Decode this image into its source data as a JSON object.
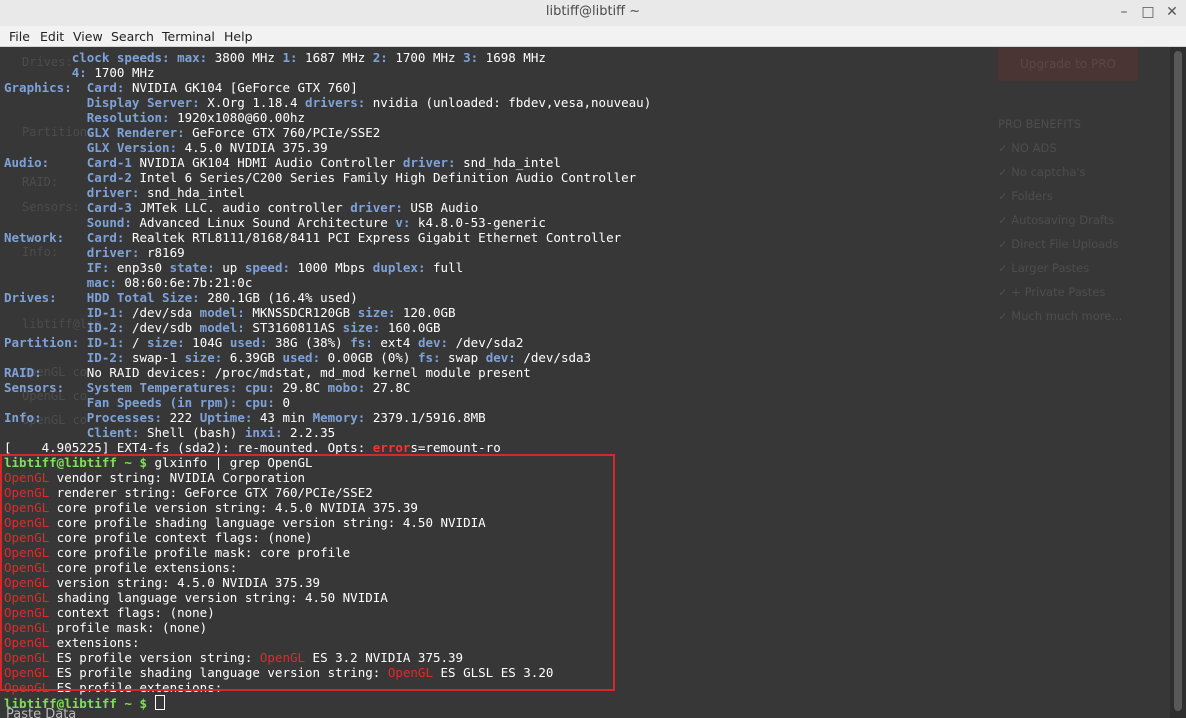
{
  "window": {
    "title": "libtiff@libtiff ~",
    "controls": {
      "minimize": "–",
      "maximize": "□",
      "close": "✕"
    }
  },
  "menu": {
    "items": [
      "File",
      "Edit",
      "View",
      "Search",
      "Terminal",
      "Help"
    ]
  },
  "terminal": {
    "lines": [
      [
        [
          "b",
          "         "
        ],
        [
          "b",
          "clock speeds: max: "
        ],
        [
          "w",
          "3800 MHz "
        ],
        [
          "b",
          "1: "
        ],
        [
          "w",
          "1687 MHz "
        ],
        [
          "b",
          "2: "
        ],
        [
          "w",
          "1700 MHz "
        ],
        [
          "b",
          "3: "
        ],
        [
          "w",
          "1698 MHz"
        ]
      ],
      [
        [
          "b",
          "         4: "
        ],
        [
          "w",
          "1700 MHz"
        ]
      ],
      [
        [
          "b",
          "Graphics:"
        ],
        [
          "b",
          "  Card: "
        ],
        [
          "w",
          "NVIDIA GK104 [GeForce GTX 760]"
        ]
      ],
      [
        [
          "b",
          "           Display Server: "
        ],
        [
          "w",
          "X.Org 1.18.4 "
        ],
        [
          "b",
          "drivers: "
        ],
        [
          "w",
          "nvidia (unloaded: fbdev,vesa,nouveau)"
        ]
      ],
      [
        [
          "b",
          "           Resolution: "
        ],
        [
          "w",
          "1920x1080@60.00hz"
        ]
      ],
      [
        [
          "b",
          "           GLX Renderer: "
        ],
        [
          "w",
          "GeForce GTX 760/PCIe/SSE2"
        ]
      ],
      [
        [
          "b",
          "           GLX Version: "
        ],
        [
          "w",
          "4.5.0 NVIDIA 375.39"
        ]
      ],
      [
        [
          "b",
          "Audio:"
        ],
        [
          "b",
          "     Card-1 "
        ],
        [
          "w",
          "NVIDIA GK104 HDMI Audio Controller "
        ],
        [
          "b",
          "driver: "
        ],
        [
          "w",
          "snd_hda_intel"
        ]
      ],
      [
        [
          "b",
          "           Card-2 "
        ],
        [
          "w",
          "Intel 6 Series/C200 Series Family High Definition Audio Controller"
        ]
      ],
      [
        [
          "b",
          "           driver: "
        ],
        [
          "w",
          "snd_hda_intel"
        ]
      ],
      [
        [
          "b",
          "           Card-3 "
        ],
        [
          "w",
          "JMTek LLC. audio controller "
        ],
        [
          "b",
          "driver: "
        ],
        [
          "w",
          "USB Audio"
        ]
      ],
      [
        [
          "b",
          "           Sound: "
        ],
        [
          "w",
          "Advanced Linux Sound Architecture "
        ],
        [
          "b",
          "v: "
        ],
        [
          "w",
          "k4.8.0-53-generic"
        ]
      ],
      [
        [
          "b",
          "Network:"
        ],
        [
          "b",
          "   Card: "
        ],
        [
          "w",
          "Realtek RTL8111/8168/8411 PCI Express Gigabit Ethernet Controller"
        ]
      ],
      [
        [
          "b",
          "           driver: "
        ],
        [
          "w",
          "r8169"
        ]
      ],
      [
        [
          "b",
          "           IF: "
        ],
        [
          "w",
          "enp3s0 "
        ],
        [
          "b",
          "state: "
        ],
        [
          "w",
          "up "
        ],
        [
          "b",
          "speed: "
        ],
        [
          "w",
          "1000 Mbps "
        ],
        [
          "b",
          "duplex: "
        ],
        [
          "w",
          "full"
        ]
      ],
      [
        [
          "b",
          "           mac: "
        ],
        [
          "w",
          "08:60:6e:7b:21:0c"
        ]
      ],
      [
        [
          "b",
          "Drives:"
        ],
        [
          "b",
          "    HDD Total Size: "
        ],
        [
          "w",
          "280.1GB (16.4% used)"
        ]
      ],
      [
        [
          "b",
          "           ID-1: "
        ],
        [
          "w",
          "/dev/sda "
        ],
        [
          "b",
          "model: "
        ],
        [
          "w",
          "MKNSSDCR120GB "
        ],
        [
          "b",
          "size: "
        ],
        [
          "w",
          "120.0GB"
        ]
      ],
      [
        [
          "b",
          "           ID-2: "
        ],
        [
          "w",
          "/dev/sdb "
        ],
        [
          "b",
          "model: "
        ],
        [
          "w",
          "ST3160811AS "
        ],
        [
          "b",
          "size: "
        ],
        [
          "w",
          "160.0GB"
        ]
      ],
      [
        [
          "b",
          "Partition:"
        ],
        [
          "b",
          " ID-1: "
        ],
        [
          "w",
          "/ "
        ],
        [
          "b",
          "size: "
        ],
        [
          "w",
          "104G "
        ],
        [
          "b",
          "used: "
        ],
        [
          "w",
          "38G (38%) "
        ],
        [
          "b",
          "fs: "
        ],
        [
          "w",
          "ext4 "
        ],
        [
          "b",
          "dev: "
        ],
        [
          "w",
          "/dev/sda2"
        ]
      ],
      [
        [
          "b",
          "           ID-2: "
        ],
        [
          "w",
          "swap-1 "
        ],
        [
          "b",
          "size: "
        ],
        [
          "w",
          "6.39GB "
        ],
        [
          "b",
          "used: "
        ],
        [
          "w",
          "0.00GB (0%) "
        ],
        [
          "b",
          "fs: "
        ],
        [
          "w",
          "swap "
        ],
        [
          "b",
          "dev: "
        ],
        [
          "w",
          "/dev/sda3"
        ]
      ],
      [
        [
          "b",
          "RAID:"
        ],
        [
          "b",
          "      "
        ],
        [
          "w",
          "No RAID devices: /proc/mdstat, md_mod kernel module present"
        ]
      ],
      [
        [
          "b",
          "Sensors:"
        ],
        [
          "b",
          "   System Temperatures: cpu: "
        ],
        [
          "w",
          "29.8C "
        ],
        [
          "b",
          "mobo: "
        ],
        [
          "w",
          "27.8C"
        ]
      ],
      [
        [
          "b",
          "           Fan Speeds (in rpm): cpu: "
        ],
        [
          "w",
          "0"
        ]
      ],
      [
        [
          "b",
          "Info:"
        ],
        [
          "b",
          "      Processes: "
        ],
        [
          "w",
          "222 "
        ],
        [
          "b",
          "Uptime: "
        ],
        [
          "w",
          "43 min "
        ],
        [
          "b",
          "Memory: "
        ],
        [
          "w",
          "2379.1/5916.8MB"
        ]
      ],
      [
        [
          "b",
          "           Client: "
        ],
        [
          "w",
          "Shell (bash) "
        ],
        [
          "b",
          "inxi: "
        ],
        [
          "w",
          "2.2.35"
        ]
      ],
      [
        [
          "w",
          "[    4.905225] EXT4-fs (sda2): re-mounted. Opts: "
        ],
        [
          "rb",
          "error"
        ],
        [
          "w",
          "s=remount-ro"
        ]
      ],
      [
        [
          "gr",
          "libtiff@libtiff ~ $ "
        ],
        [
          "w",
          "glxinfo | grep OpenGL"
        ]
      ],
      [
        [
          "r",
          "OpenGL"
        ],
        [
          "w",
          " vendor string: NVIDIA Corporation"
        ]
      ],
      [
        [
          "r",
          "OpenGL"
        ],
        [
          "w",
          " renderer string: GeForce GTX 760/PCIe/SSE2"
        ]
      ],
      [
        [
          "r",
          "OpenGL"
        ],
        [
          "w",
          " core profile version string: 4.5.0 NVIDIA 375.39"
        ]
      ],
      [
        [
          "r",
          "OpenGL"
        ],
        [
          "w",
          " core profile shading language version string: 4.50 NVIDIA"
        ]
      ],
      [
        [
          "r",
          "OpenGL"
        ],
        [
          "w",
          " core profile context flags: (none)"
        ]
      ],
      [
        [
          "r",
          "OpenGL"
        ],
        [
          "w",
          " core profile profile mask: core profile"
        ]
      ],
      [
        [
          "r",
          "OpenGL"
        ],
        [
          "w",
          " core profile extensions:"
        ]
      ],
      [
        [
          "r",
          "OpenGL"
        ],
        [
          "w",
          " version string: 4.5.0 NVIDIA 375.39"
        ]
      ],
      [
        [
          "r",
          "OpenGL"
        ],
        [
          "w",
          " shading language version string: 4.50 NVIDIA"
        ]
      ],
      [
        [
          "r",
          "OpenGL"
        ],
        [
          "w",
          " context flags: (none)"
        ]
      ],
      [
        [
          "r",
          "OpenGL"
        ],
        [
          "w",
          " profile mask: (none)"
        ]
      ],
      [
        [
          "r",
          "OpenGL"
        ],
        [
          "w",
          " extensions:"
        ]
      ],
      [
        [
          "r",
          "OpenGL"
        ],
        [
          "w",
          " ES profile version string: "
        ],
        [
          "r",
          "OpenGL"
        ],
        [
          "w",
          " ES 3.2 NVIDIA 375.39"
        ]
      ],
      [
        [
          "r",
          "OpenGL"
        ],
        [
          "w",
          " ES profile shading language version string: "
        ],
        [
          "r",
          "OpenGL"
        ],
        [
          "w",
          " ES GLSL ES 3.20"
        ]
      ],
      [
        [
          "r",
          "OpenGL"
        ],
        [
          "w",
          " ES profile extensions:"
        ]
      ],
      [
        [
          "gr",
          "libtiff@libtiff ~ $ "
        ]
      ]
    ]
  },
  "background_bleed": {
    "upgrade": "Upgrade to PRO",
    "pro_header": "PRO BENEFITS",
    "pro_items": [
      "✓ NO ADS",
      "✓ No captcha's",
      "✓ Folders",
      "✓ Autosaving Drafts",
      "✓ Direct File Uploads",
      "✓ Larger Pastes",
      "✓ + Private Pastes",
      "✓ Much much more..."
    ],
    "left_ghosts": [
      "Drives:",
      "Partition:",
      "RAID:",
      "Sensors:",
      "Info:",
      "libtiff@lib",
      "OpenGL co",
      "OpenGL co",
      "OpenGL co"
    ],
    "bottom_label": "Paste Data",
    "colors": {
      "terminal_bg": "#373737",
      "highlight": "#d22a2a",
      "prompt": "#7ee05a",
      "label": "#7ea2d8"
    }
  }
}
